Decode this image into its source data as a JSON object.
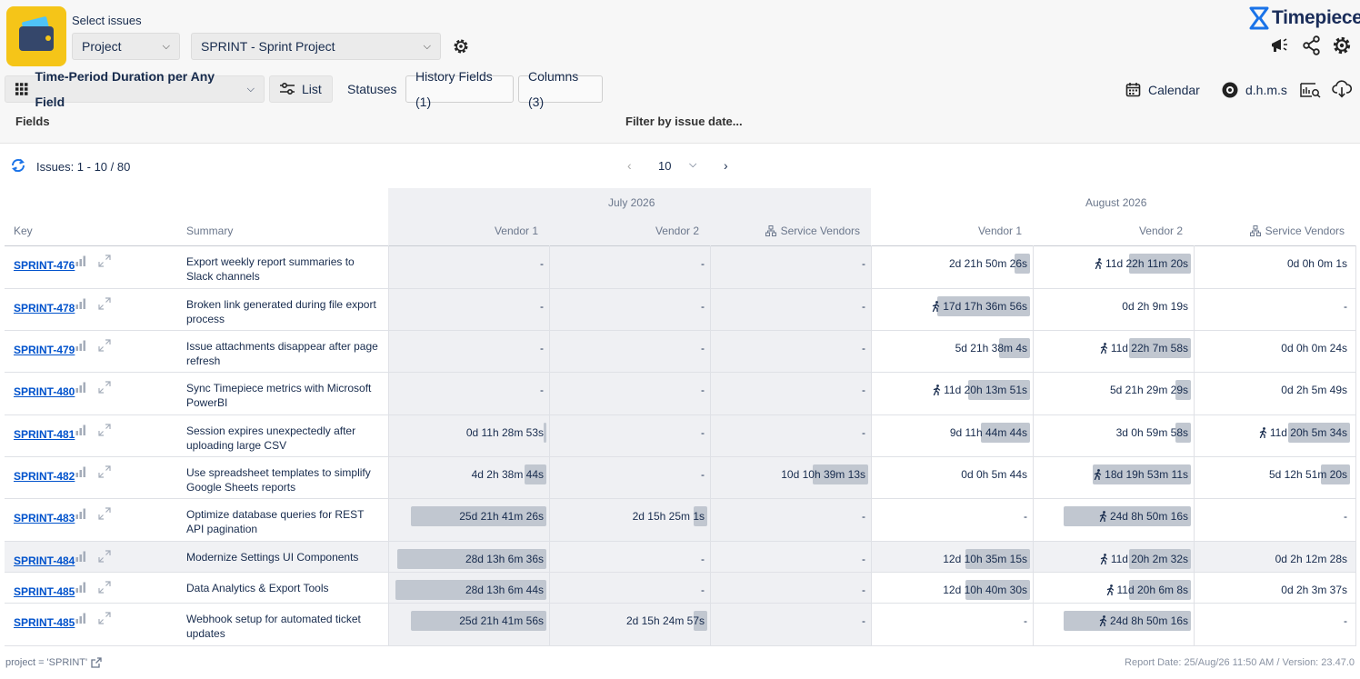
{
  "header": {
    "select_title": "Select issues",
    "project_type": "Project",
    "project_value": "SPRINT - Sprint Project",
    "brand": "Timepiece"
  },
  "toolbar": {
    "report_type": "Time-Period Duration per Any Field",
    "list_label": "List",
    "statuses_label": "Statuses",
    "history_fields_label": "History Fields (1)",
    "columns_label": "Columns (3)",
    "calendar_label": "Calendar",
    "format_label": "d.h.m.s"
  },
  "filters": {
    "fields_label": "Fields",
    "filter_label": "Filter by issue date..."
  },
  "pagination": {
    "issues_text": "Issues: 1 - 10 / 80",
    "page_size": "10"
  },
  "table": {
    "key_header": "Key",
    "summary_header": "Summary",
    "months": [
      "July 2026",
      "August 2026"
    ],
    "columns": [
      "Vendor 1",
      "Vendor 2",
      "Service Vendors",
      "Vendor 1",
      "Vendor 2",
      "Service Vendors"
    ],
    "rows": [
      {
        "key": "SPRINT-476",
        "summary": "Export weekly report summaries to Slack channels",
        "cells": [
          {
            "t": "-"
          },
          {
            "t": "-"
          },
          {
            "t": "-"
          },
          {
            "t": "2d 21h 50m 26s",
            "f": 0.1
          },
          {
            "t": "11d 22h 11m 20s",
            "f": 0.4,
            "run": true
          },
          {
            "t": "0d 0h 0m 1s"
          }
        ]
      },
      {
        "key": "SPRINT-478",
        "summary": "Broken link generated during file export process",
        "cells": [
          {
            "t": "-"
          },
          {
            "t": "-"
          },
          {
            "t": "-"
          },
          {
            "t": "17d 17h 36m 56s",
            "f": 0.6,
            "run": true
          },
          {
            "t": "0d 2h 9m 19s"
          },
          {
            "t": "-"
          }
        ]
      },
      {
        "key": "SPRINT-479",
        "summary": "Issue attachments disappear after page refresh",
        "cells": [
          {
            "t": "-"
          },
          {
            "t": "-"
          },
          {
            "t": "-"
          },
          {
            "t": "5d 21h 38m 4s",
            "f": 0.2
          },
          {
            "t": "11d 22h 7m 58s",
            "f": 0.4,
            "run": true
          },
          {
            "t": "0d 0h 0m 24s"
          }
        ]
      },
      {
        "key": "SPRINT-480",
        "summary": "Sync Timepiece metrics with Microsoft PowerBI",
        "cells": [
          {
            "t": "-"
          },
          {
            "t": "-"
          },
          {
            "t": "-"
          },
          {
            "t": "11d 20h 13m 51s",
            "f": 0.4,
            "run": true
          },
          {
            "t": "5d 21h 29m 29s",
            "f": 0.1
          },
          {
            "t": "0d 2h 5m 49s"
          }
        ]
      },
      {
        "key": "SPRINT-481",
        "summary": "Session expires unexpectedly after uploading large CSV",
        "cells": [
          {
            "t": "0d 11h 28m 53s",
            "f": 0.02
          },
          {
            "t": "-"
          },
          {
            "t": "-"
          },
          {
            "t": "9d 11h 44m 44s",
            "f": 0.32
          },
          {
            "t": "3d 0h 59m 58s",
            "f": 0.1
          },
          {
            "t": "11d 20h 5m 34s",
            "f": 0.4,
            "run": true
          }
        ]
      },
      {
        "key": "SPRINT-482",
        "summary": "Use spreadsheet templates to simplify Google Sheets reports",
        "cells": [
          {
            "t": "4d 2h 38m 44s",
            "f": 0.14
          },
          {
            "t": "-"
          },
          {
            "t": "10d 10h 39m 13s",
            "f": 0.36
          },
          {
            "t": "0d 0h 5m 44s"
          },
          {
            "t": "18d 19h 53m 11s",
            "f": 0.64,
            "run": true
          },
          {
            "t": "5d 12h 51m 20s",
            "f": 0.19
          }
        ]
      },
      {
        "key": "SPRINT-483",
        "summary": "Optimize database queries for REST API pagination",
        "cells": [
          {
            "t": "25d 21h 41m 26s",
            "f": 0.88
          },
          {
            "t": "2d 15h 25m 1s",
            "f": 0.09
          },
          {
            "t": "-"
          },
          {
            "t": "-"
          },
          {
            "t": "24d 8h 50m 16s",
            "f": 0.83,
            "run": true
          },
          {
            "t": "-"
          }
        ]
      },
      {
        "key": "SPRINT-484",
        "summary": "Modernize Settings UI Components",
        "hl": true,
        "cells": [
          {
            "t": "28d 13h 6m 36s",
            "f": 0.97
          },
          {
            "t": "-"
          },
          {
            "t": "-"
          },
          {
            "t": "12d 10h 35m 15s",
            "f": 0.42
          },
          {
            "t": "11d 20h 2m 32s",
            "f": 0.4,
            "run": true
          },
          {
            "t": "0d 2h 12m 28s"
          }
        ]
      },
      {
        "key": "SPRINT-485",
        "summary": "Data Analytics & Export Tools",
        "cells": [
          {
            "t": "28d 13h 6m 44s",
            "f": 0.98
          },
          {
            "t": "-"
          },
          {
            "t": "-"
          },
          {
            "t": "12d 10h 40m 30s",
            "f": 0.42
          },
          {
            "t": "11d 20h 6m 8s",
            "f": 0.4,
            "run": true
          },
          {
            "t": "0d 2h 3m 37s"
          }
        ]
      },
      {
        "key": "SPRINT-485",
        "summary": "Webhook setup for automated ticket updates",
        "cells": [
          {
            "t": "25d 21h 41m 56s",
            "f": 0.88
          },
          {
            "t": "2d 15h 24m 57s",
            "f": 0.09
          },
          {
            "t": "-"
          },
          {
            "t": "-"
          },
          {
            "t": "24d 8h 50m 16s",
            "f": 0.83,
            "run": true
          },
          {
            "t": "-"
          }
        ]
      }
    ]
  },
  "footer": {
    "jql": "project = 'SPRINT'",
    "report_info": "Report Date: 25/Aug/26 11:50 AM / Version: 23.47.0"
  },
  "colors": {
    "link": "#0052cc",
    "bar": "#c1c7d0",
    "month_band": "#eff0f3",
    "logo_bg": "#f5c518",
    "brand": "#1a2d5a"
  }
}
